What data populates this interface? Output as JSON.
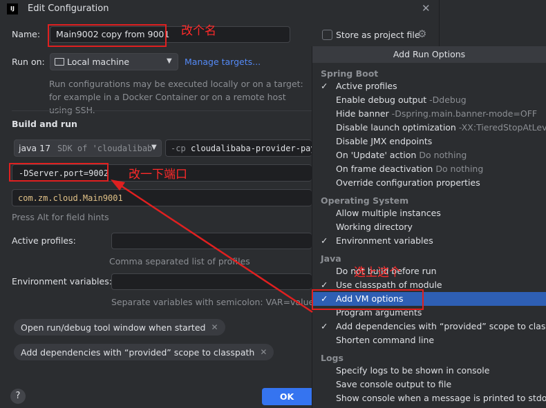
{
  "window": {
    "title": "Edit Configuration",
    "app_icon_text": "IJ"
  },
  "name_row": {
    "label": "Name:",
    "value": "Main9002 copy from 9001"
  },
  "store_project": {
    "label": "Store as project file"
  },
  "run_on": {
    "label": "Run on:",
    "value": "Local machine",
    "manage_link": "Manage targets..."
  },
  "run_on_hint": "Run configurations may be executed locally or on a target: for example in a Docker Container or on a remote host using SSH.",
  "build_run": {
    "heading": "Build and run",
    "jdk_name": "java 17",
    "jdk_detail": "SDK of 'cloudalibab",
    "cp_prefix": "-cp",
    "cp_value": "cloudalibaba-provider-pay",
    "vm_options": "-DServer.port=9002",
    "main_class": "com.zm.cloud.Main9001",
    "field_hint": "Press Alt for field hints"
  },
  "active_profiles": {
    "label": "Active profiles:",
    "hint": "Comma separated list of profiles"
  },
  "env_vars": {
    "label": "Environment variables:",
    "hint": "Separate variables with semicolon: VAR=value; VA"
  },
  "chips": [
    {
      "label": "Open run/debug tool window when started"
    },
    {
      "label": "Add dependencies with “provided” scope to classpath"
    }
  ],
  "footer": {
    "ok_label": "OK",
    "help_label": "?"
  },
  "annotations": {
    "rename": "改个名",
    "change_port": "改一下端口",
    "select_this": "选上这个"
  },
  "popup": {
    "title": "Add Run Options",
    "sections": [
      {
        "heading": "Spring Boot",
        "items": [
          {
            "label": "Active profiles",
            "hint": "",
            "checked": true
          },
          {
            "label": "Enable debug output",
            "hint": "-Ddebug",
            "checked": false
          },
          {
            "label": "Hide banner",
            "hint": "-Dspring.main.banner-mode=OFF",
            "checked": false
          },
          {
            "label": "Disable launch optimization",
            "hint": "-XX:TieredStopAtLev...",
            "checked": false
          },
          {
            "label": "Disable JMX endpoints",
            "hint": "",
            "checked": false
          },
          {
            "label": "On 'Update' action",
            "hint": "Do nothing",
            "checked": false
          },
          {
            "label": "On frame deactivation",
            "hint": "Do nothing",
            "checked": false
          },
          {
            "label": "Override configuration properties",
            "hint": "",
            "checked": false
          }
        ]
      },
      {
        "heading": "Operating System",
        "items": [
          {
            "label": "Allow multiple instances",
            "hint": "",
            "checked": false
          },
          {
            "label": "Working directory",
            "hint": "",
            "checked": false
          },
          {
            "label": "Environment variables",
            "hint": "",
            "checked": true
          }
        ]
      },
      {
        "heading": "Java",
        "items": [
          {
            "label": "Do not build before run",
            "hint": "",
            "checked": false
          },
          {
            "label": "Use classpath of module",
            "hint": "",
            "checked": true
          },
          {
            "label": "Add VM options",
            "hint": "",
            "checked": true,
            "selected": true
          },
          {
            "label": "Program arguments",
            "hint": "",
            "checked": false
          },
          {
            "label": "Add dependencies with “provided” scope to classpa",
            "hint": "",
            "checked": true
          },
          {
            "label": "Shorten command line",
            "hint": "",
            "checked": false
          }
        ]
      },
      {
        "heading": "Logs",
        "items": [
          {
            "label": "Specify logs to be shown in console",
            "hint": "",
            "checked": false
          },
          {
            "label": "Save console output to file",
            "hint": "",
            "checked": false
          },
          {
            "label": "Show console when a message is printed to stdout",
            "hint": "",
            "checked": false
          }
        ]
      }
    ]
  },
  "colors": {
    "accent": "#3574f0",
    "selection": "#2e5fb4",
    "annotation": "#e02020"
  }
}
